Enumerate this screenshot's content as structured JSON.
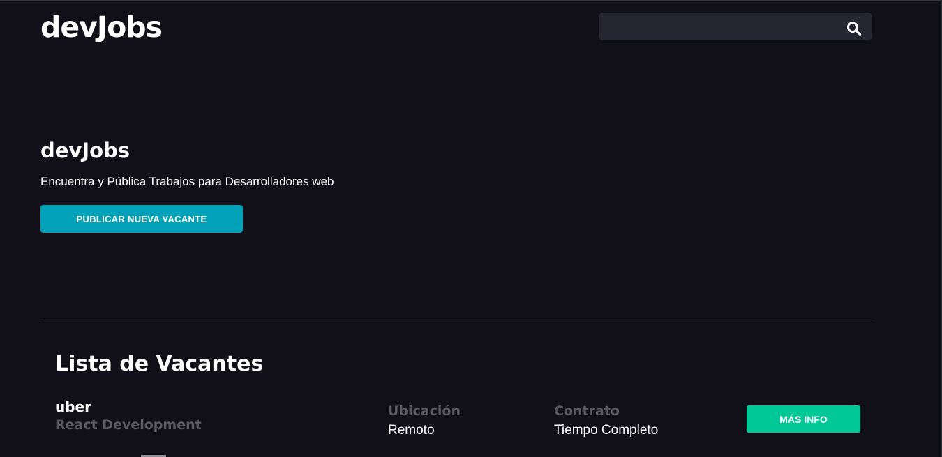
{
  "header": {
    "logo_text": "devJobs",
    "search": {
      "value": "",
      "placeholder": ""
    },
    "search_icon": "search-icon"
  },
  "hero": {
    "title": "devJobs",
    "subtitle": "Encuentra y Pública Trabajos para Desarrolladores web",
    "publish_button_label": "PUBLICAR NUEVA VACANTE"
  },
  "vacancies": {
    "title": "Lista de Vacantes",
    "items": [
      {
        "company": "uber",
        "position": "React Development",
        "location_label": "Ubicación",
        "location": "Remoto",
        "contract_label": "Contrato",
        "contract": "Tiempo Completo",
        "button_label": "MÁS INFO"
      }
    ]
  },
  "colors": {
    "background": "#111019",
    "search_bg": "#262532",
    "publish_button": "#01a2b7",
    "info_button": "#00c897",
    "muted_text": "#5b5a64",
    "text": "#ffffff"
  }
}
